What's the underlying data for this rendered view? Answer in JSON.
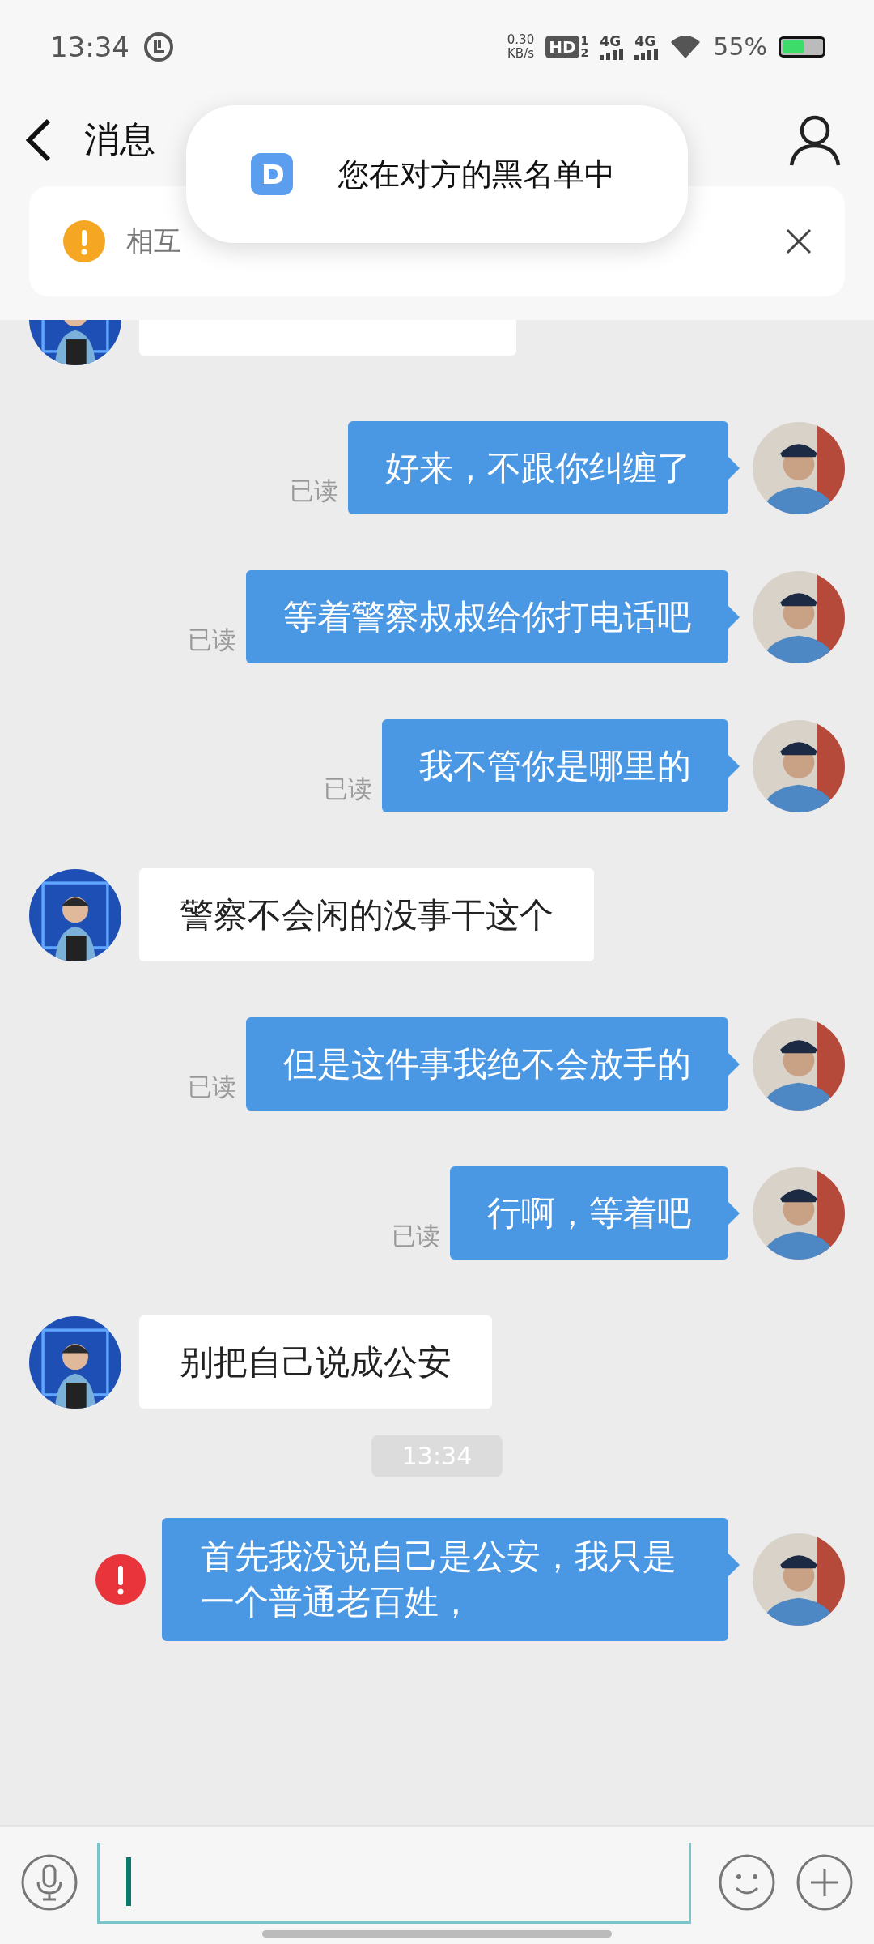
{
  "status_bar": {
    "time": "13:34",
    "net_speed": "0.30",
    "net_unit": "KB/s",
    "hd": "HD",
    "hd_sup": "1",
    "hd_sub": "2",
    "sim1": "4G",
    "sim2": "4G",
    "battery": "55%"
  },
  "header": {
    "title": "消息"
  },
  "notice": {
    "text": "相互"
  },
  "toast": {
    "text": "您在对方的黑名单中"
  },
  "messages": [
    {
      "kind": "received"
    },
    {
      "kind": "sent",
      "text": "好来，不跟你纠缠了",
      "receipt": "已读",
      "failed": false
    },
    {
      "kind": "sent",
      "text": "等着警察叔叔给你打电话吧",
      "receipt": "已读",
      "failed": false
    },
    {
      "kind": "sent",
      "text": "我不管你是哪里的",
      "receipt": "已读",
      "failed": false
    },
    {
      "kind": "received",
      "text": "警察不会闲的没事干这个"
    },
    {
      "kind": "sent",
      "text": "但是这件事我绝不会放手的",
      "receipt": "已读",
      "failed": false
    },
    {
      "kind": "sent",
      "text": "行啊，等着吧",
      "receipt": "已读",
      "failed": false
    },
    {
      "kind": "received",
      "text": "别把自己说成公安"
    },
    {
      "kind": "time",
      "text": "13:34"
    },
    {
      "kind": "sent",
      "text": "首先我没说自己是公安，我只是一个普通老百姓，",
      "failed": true
    }
  ]
}
